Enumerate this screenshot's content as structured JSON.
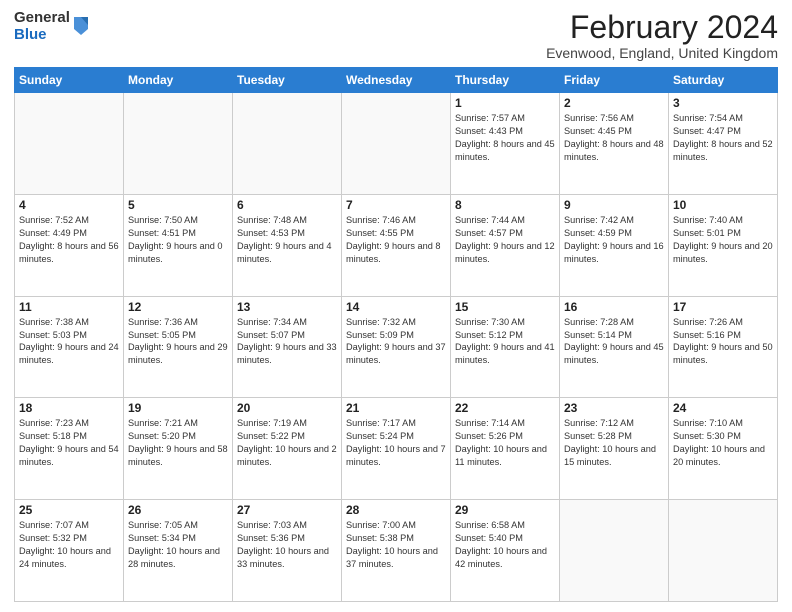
{
  "logo": {
    "general": "General",
    "blue": "Blue"
  },
  "header": {
    "title": "February 2024",
    "subtitle": "Evenwood, England, United Kingdom"
  },
  "columns": [
    "Sunday",
    "Monday",
    "Tuesday",
    "Wednesday",
    "Thursday",
    "Friday",
    "Saturday"
  ],
  "weeks": [
    [
      {
        "day": "",
        "info": ""
      },
      {
        "day": "",
        "info": ""
      },
      {
        "day": "",
        "info": ""
      },
      {
        "day": "",
        "info": ""
      },
      {
        "day": "1",
        "info": "Sunrise: 7:57 AM\nSunset: 4:43 PM\nDaylight: 8 hours and 45 minutes."
      },
      {
        "day": "2",
        "info": "Sunrise: 7:56 AM\nSunset: 4:45 PM\nDaylight: 8 hours and 48 minutes."
      },
      {
        "day": "3",
        "info": "Sunrise: 7:54 AM\nSunset: 4:47 PM\nDaylight: 8 hours and 52 minutes."
      }
    ],
    [
      {
        "day": "4",
        "info": "Sunrise: 7:52 AM\nSunset: 4:49 PM\nDaylight: 8 hours and 56 minutes."
      },
      {
        "day": "5",
        "info": "Sunrise: 7:50 AM\nSunset: 4:51 PM\nDaylight: 9 hours and 0 minutes."
      },
      {
        "day": "6",
        "info": "Sunrise: 7:48 AM\nSunset: 4:53 PM\nDaylight: 9 hours and 4 minutes."
      },
      {
        "day": "7",
        "info": "Sunrise: 7:46 AM\nSunset: 4:55 PM\nDaylight: 9 hours and 8 minutes."
      },
      {
        "day": "8",
        "info": "Sunrise: 7:44 AM\nSunset: 4:57 PM\nDaylight: 9 hours and 12 minutes."
      },
      {
        "day": "9",
        "info": "Sunrise: 7:42 AM\nSunset: 4:59 PM\nDaylight: 9 hours and 16 minutes."
      },
      {
        "day": "10",
        "info": "Sunrise: 7:40 AM\nSunset: 5:01 PM\nDaylight: 9 hours and 20 minutes."
      }
    ],
    [
      {
        "day": "11",
        "info": "Sunrise: 7:38 AM\nSunset: 5:03 PM\nDaylight: 9 hours and 24 minutes."
      },
      {
        "day": "12",
        "info": "Sunrise: 7:36 AM\nSunset: 5:05 PM\nDaylight: 9 hours and 29 minutes."
      },
      {
        "day": "13",
        "info": "Sunrise: 7:34 AM\nSunset: 5:07 PM\nDaylight: 9 hours and 33 minutes."
      },
      {
        "day": "14",
        "info": "Sunrise: 7:32 AM\nSunset: 5:09 PM\nDaylight: 9 hours and 37 minutes."
      },
      {
        "day": "15",
        "info": "Sunrise: 7:30 AM\nSunset: 5:12 PM\nDaylight: 9 hours and 41 minutes."
      },
      {
        "day": "16",
        "info": "Sunrise: 7:28 AM\nSunset: 5:14 PM\nDaylight: 9 hours and 45 minutes."
      },
      {
        "day": "17",
        "info": "Sunrise: 7:26 AM\nSunset: 5:16 PM\nDaylight: 9 hours and 50 minutes."
      }
    ],
    [
      {
        "day": "18",
        "info": "Sunrise: 7:23 AM\nSunset: 5:18 PM\nDaylight: 9 hours and 54 minutes."
      },
      {
        "day": "19",
        "info": "Sunrise: 7:21 AM\nSunset: 5:20 PM\nDaylight: 9 hours and 58 minutes."
      },
      {
        "day": "20",
        "info": "Sunrise: 7:19 AM\nSunset: 5:22 PM\nDaylight: 10 hours and 2 minutes."
      },
      {
        "day": "21",
        "info": "Sunrise: 7:17 AM\nSunset: 5:24 PM\nDaylight: 10 hours and 7 minutes."
      },
      {
        "day": "22",
        "info": "Sunrise: 7:14 AM\nSunset: 5:26 PM\nDaylight: 10 hours and 11 minutes."
      },
      {
        "day": "23",
        "info": "Sunrise: 7:12 AM\nSunset: 5:28 PM\nDaylight: 10 hours and 15 minutes."
      },
      {
        "day": "24",
        "info": "Sunrise: 7:10 AM\nSunset: 5:30 PM\nDaylight: 10 hours and 20 minutes."
      }
    ],
    [
      {
        "day": "25",
        "info": "Sunrise: 7:07 AM\nSunset: 5:32 PM\nDaylight: 10 hours and 24 minutes."
      },
      {
        "day": "26",
        "info": "Sunrise: 7:05 AM\nSunset: 5:34 PM\nDaylight: 10 hours and 28 minutes."
      },
      {
        "day": "27",
        "info": "Sunrise: 7:03 AM\nSunset: 5:36 PM\nDaylight: 10 hours and 33 minutes."
      },
      {
        "day": "28",
        "info": "Sunrise: 7:00 AM\nSunset: 5:38 PM\nDaylight: 10 hours and 37 minutes."
      },
      {
        "day": "29",
        "info": "Sunrise: 6:58 AM\nSunset: 5:40 PM\nDaylight: 10 hours and 42 minutes."
      },
      {
        "day": "",
        "info": ""
      },
      {
        "day": "",
        "info": ""
      }
    ]
  ]
}
